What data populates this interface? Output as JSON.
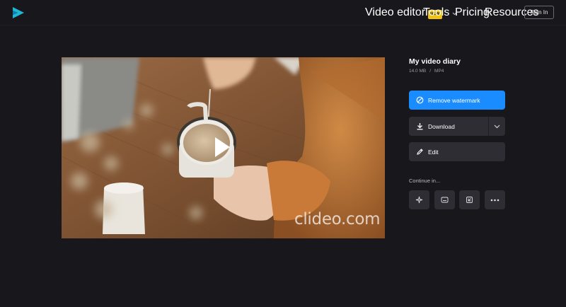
{
  "header": {
    "nav": {
      "video_editor": "Video editor",
      "badge_new": "NEW",
      "tools": "Tools",
      "pricing": "Pricing",
      "resources": "Resources"
    },
    "sign_in": "Sign In"
  },
  "video": {
    "watermark_text": "clideo.com"
  },
  "file": {
    "title": "My video diary",
    "size": "14.0 MB",
    "separator": "/",
    "format": "MP4"
  },
  "actions": {
    "remove_watermark": "Remove watermark",
    "download": "Download",
    "edit": "Edit"
  },
  "continue_label": "Continue in...",
  "colors": {
    "background": "#18181c",
    "accent_blue": "#1a8cff",
    "button_dark": "#2d2d33",
    "badge_yellow": "#f3c213",
    "logo_teal": "#1fb6d6"
  }
}
